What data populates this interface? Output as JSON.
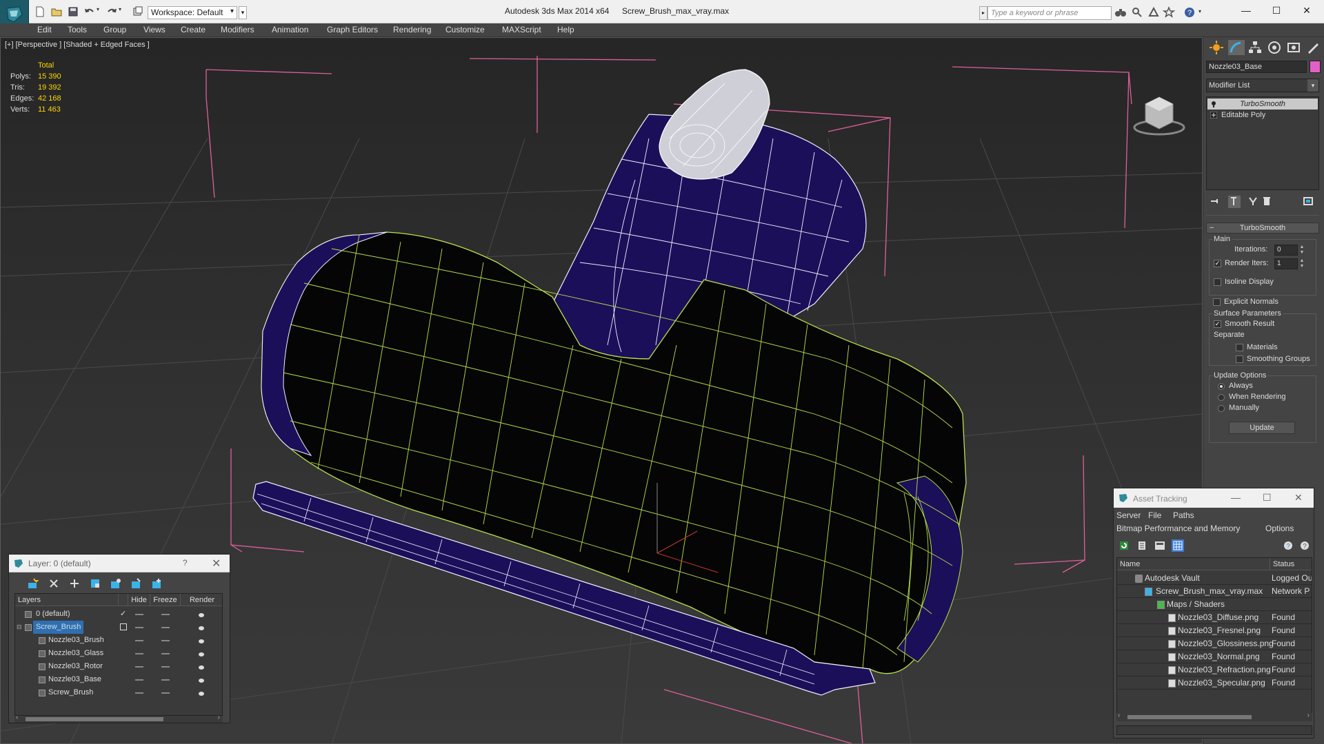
{
  "titlebar": {
    "workspace": "Workspace: Default",
    "app_title": "Autodesk 3ds Max  2014 x64",
    "file_title": "Screw_Brush_max_vray.max",
    "search_placeholder": "Type a keyword or phrase",
    "minimize": "—",
    "maximize": "☐",
    "close": "✕"
  },
  "menubar": {
    "items": [
      "Edit",
      "Tools",
      "Group",
      "Views",
      "Create",
      "Modifiers",
      "Animation",
      "Graph Editors",
      "Rendering",
      "Customize",
      "MAXScript",
      "Help"
    ]
  },
  "viewport": {
    "label": "[+] [Perspective ] [Shaded + Edged Faces ]",
    "stats": {
      "header": "Total",
      "rows": [
        {
          "label": "Polys:",
          "value": "15 390"
        },
        {
          "label": "Tris:",
          "value": "19 392"
        },
        {
          "label": "Edges:",
          "value": "42 168"
        },
        {
          "label": "Verts:",
          "value": "11 463"
        }
      ]
    }
  },
  "command_panel": {
    "object_name": "Nozzle03_Base",
    "object_color": "#e35fc8",
    "modifier_list": "Modifier List",
    "stack": [
      {
        "label": "TurboSmooth",
        "selected": true
      },
      {
        "label": "Editable Poly",
        "selected": false
      }
    ],
    "rollout": {
      "title": "TurboSmooth",
      "main_group": "Main",
      "iterations_label": "Iterations:",
      "iterations_value": "0",
      "render_iters_label": "Render Iters:",
      "render_iters_value": "1",
      "render_iters_checked": true,
      "isoline_label": "Isoline Display",
      "explicit_normals_label": "Explicit Normals",
      "surface_group": "Surface Parameters",
      "smooth_result_label": "Smooth Result",
      "separate_label": "Separate",
      "materials_label": "Materials",
      "smoothing_groups_label": "Smoothing Groups",
      "update_group": "Update Options",
      "always_label": "Always",
      "when_rendering_label": "When Rendering",
      "manually_label": "Manually",
      "update_button": "Update"
    }
  },
  "layer_panel": {
    "title": "Layer: 0 (default)",
    "help": "?",
    "close": "✕",
    "columns": [
      "Layers",
      "Hide",
      "Freeze",
      "Render"
    ],
    "rows": [
      {
        "name": "0 (default)",
        "indent": 1,
        "selected": false,
        "check": "✓"
      },
      {
        "name": "Screw_Brush",
        "indent": 1,
        "selected": true,
        "check": ""
      },
      {
        "name": "Nozzle03_Brush",
        "indent": 2,
        "selected": false,
        "check": ""
      },
      {
        "name": "Nozzle03_Glass",
        "indent": 2,
        "selected": false,
        "check": ""
      },
      {
        "name": "Nozzle03_Rotor",
        "indent": 2,
        "selected": false,
        "check": ""
      },
      {
        "name": "Nozzle03_Base",
        "indent": 2,
        "selected": false,
        "check": ""
      },
      {
        "name": "Screw_Brush",
        "indent": 2,
        "selected": false,
        "check": ""
      }
    ]
  },
  "asset_panel": {
    "title": "Asset Tracking",
    "menu1": [
      "Server",
      "File",
      "Paths"
    ],
    "menu2": [
      "Bitmap Performance and Memory",
      "Options"
    ],
    "columns": [
      "Name",
      "Status"
    ],
    "rows": [
      {
        "name": "Autodesk Vault",
        "status": "Logged Ou",
        "indent": 1
      },
      {
        "name": "Screw_Brush_max_vray.max",
        "status": "Network P",
        "indent": 2
      },
      {
        "name": "Maps / Shaders",
        "status": "",
        "indent": 3
      },
      {
        "name": "Nozzle03_Diffuse.png",
        "status": "Found",
        "indent": 4
      },
      {
        "name": "Nozzle03_Fresnel.png",
        "status": "Found",
        "indent": 4
      },
      {
        "name": "Nozzle03_Glossiness.png",
        "status": "Found",
        "indent": 4
      },
      {
        "name": "Nozzle03_Normal.png",
        "status": "Found",
        "indent": 4
      },
      {
        "name": "Nozzle03_Refraction.png",
        "status": "Found",
        "indent": 4
      },
      {
        "name": "Nozzle03_Specular.png",
        "status": "Found",
        "indent": 4
      }
    ]
  },
  "colors": {
    "wire_green": "#b9e34a",
    "wire_white": "#f2f2ff",
    "mesh_purple": "#1c0f5a",
    "bbox_pink": "#e0609a",
    "stats_yellow": "#ffd700"
  }
}
